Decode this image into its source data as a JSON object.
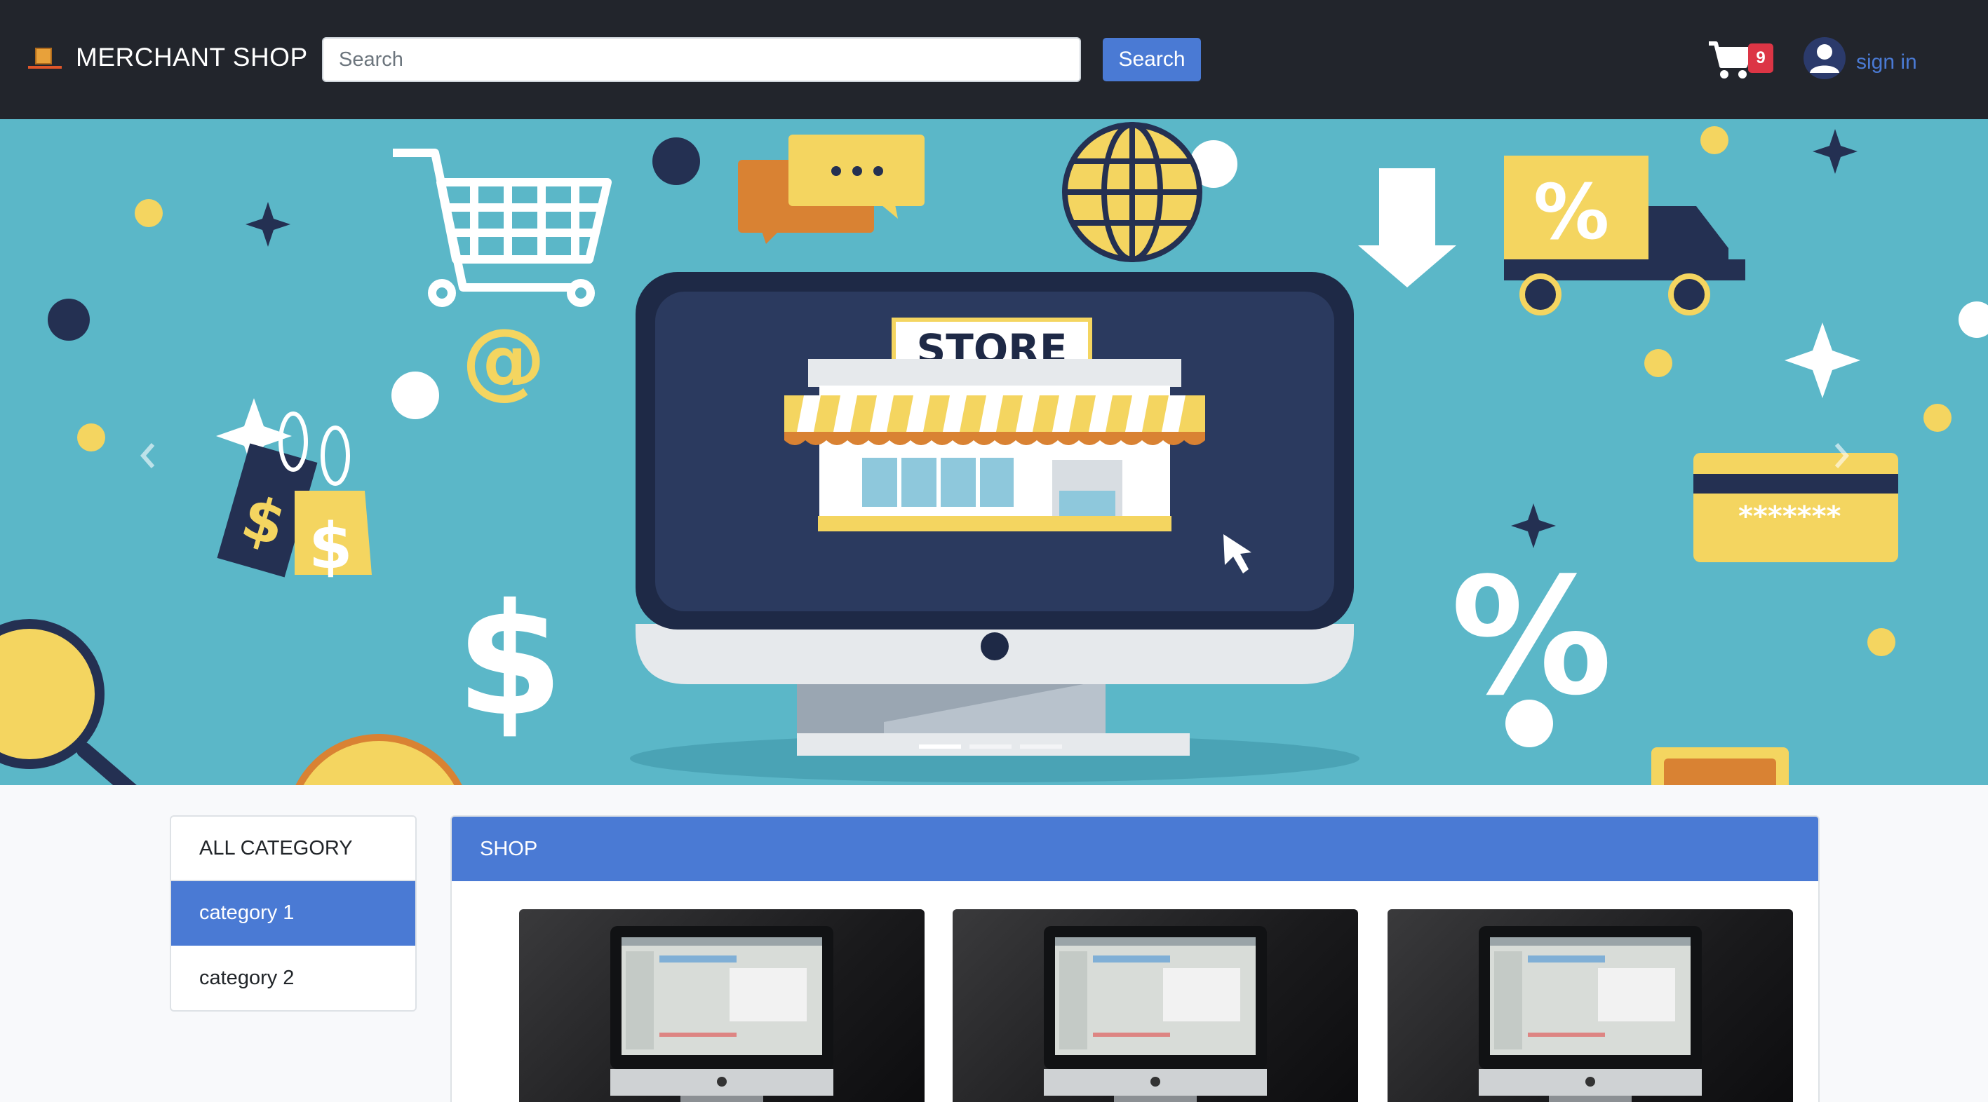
{
  "navbar": {
    "brand": "MERCHANT SHOP",
    "search_placeholder": "Search",
    "search_value": "",
    "search_button": "Search",
    "cart_count": "9",
    "signin_label": "sign in",
    "icons": [
      "brand-logo-icon",
      "cart-icon",
      "user-icon"
    ]
  },
  "hero": {
    "store_sign": "STORE",
    "card_number": "*******",
    "slide_count": 3,
    "active_slide": 1,
    "background": "#5bb7c8"
  },
  "sidebar": {
    "items": [
      {
        "label": "ALL CATEGORY",
        "active": false
      },
      {
        "label": "category 1",
        "active": true
      },
      {
        "label": "category 2",
        "active": false
      }
    ]
  },
  "shop": {
    "title": "SHOP",
    "products": [
      {
        "image": "imac-screen-image"
      },
      {
        "image": "imac-screen-image"
      },
      {
        "image": "imac-screen-image"
      }
    ]
  },
  "colors": {
    "navbar_bg": "#22252c",
    "accent": "#4a7ad4",
    "badge": "#dc3545"
  }
}
